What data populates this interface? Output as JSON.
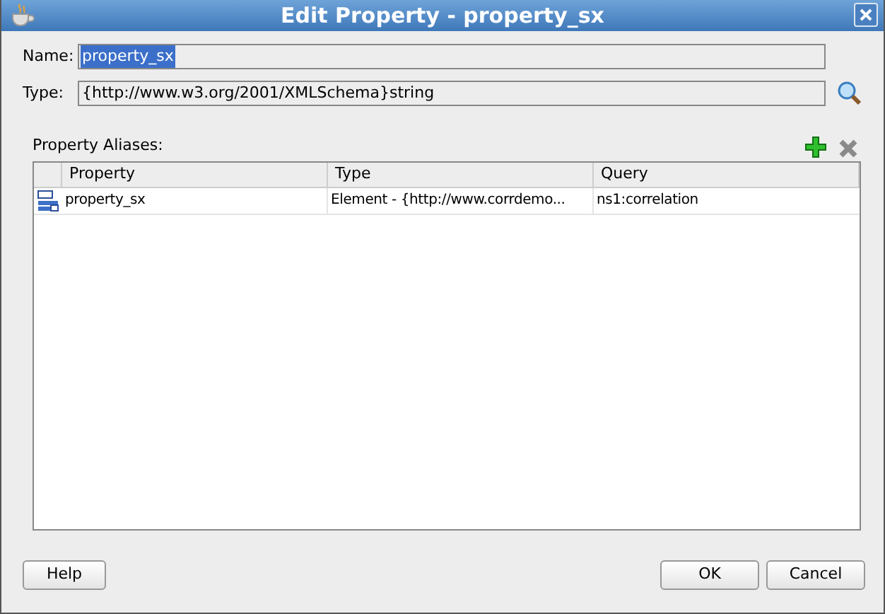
{
  "window": {
    "title": "Edit Property - property_sx"
  },
  "name_field": {
    "label": "Name:",
    "value": "property_sx",
    "selected_text": true
  },
  "type_field": {
    "label": "Type:",
    "value": "{http://www.w3.org/2001/XMLSchema}string"
  },
  "aliases": {
    "label": "Property Aliases:",
    "columns": [
      "Property",
      "Type",
      "Query"
    ],
    "rows": [
      {
        "property": "property_sx",
        "type": "Element - {http://www.corrdemo...",
        "query": "ns1:correlation"
      }
    ]
  },
  "buttons": {
    "help": "Help",
    "ok": "OK",
    "cancel": "Cancel"
  }
}
